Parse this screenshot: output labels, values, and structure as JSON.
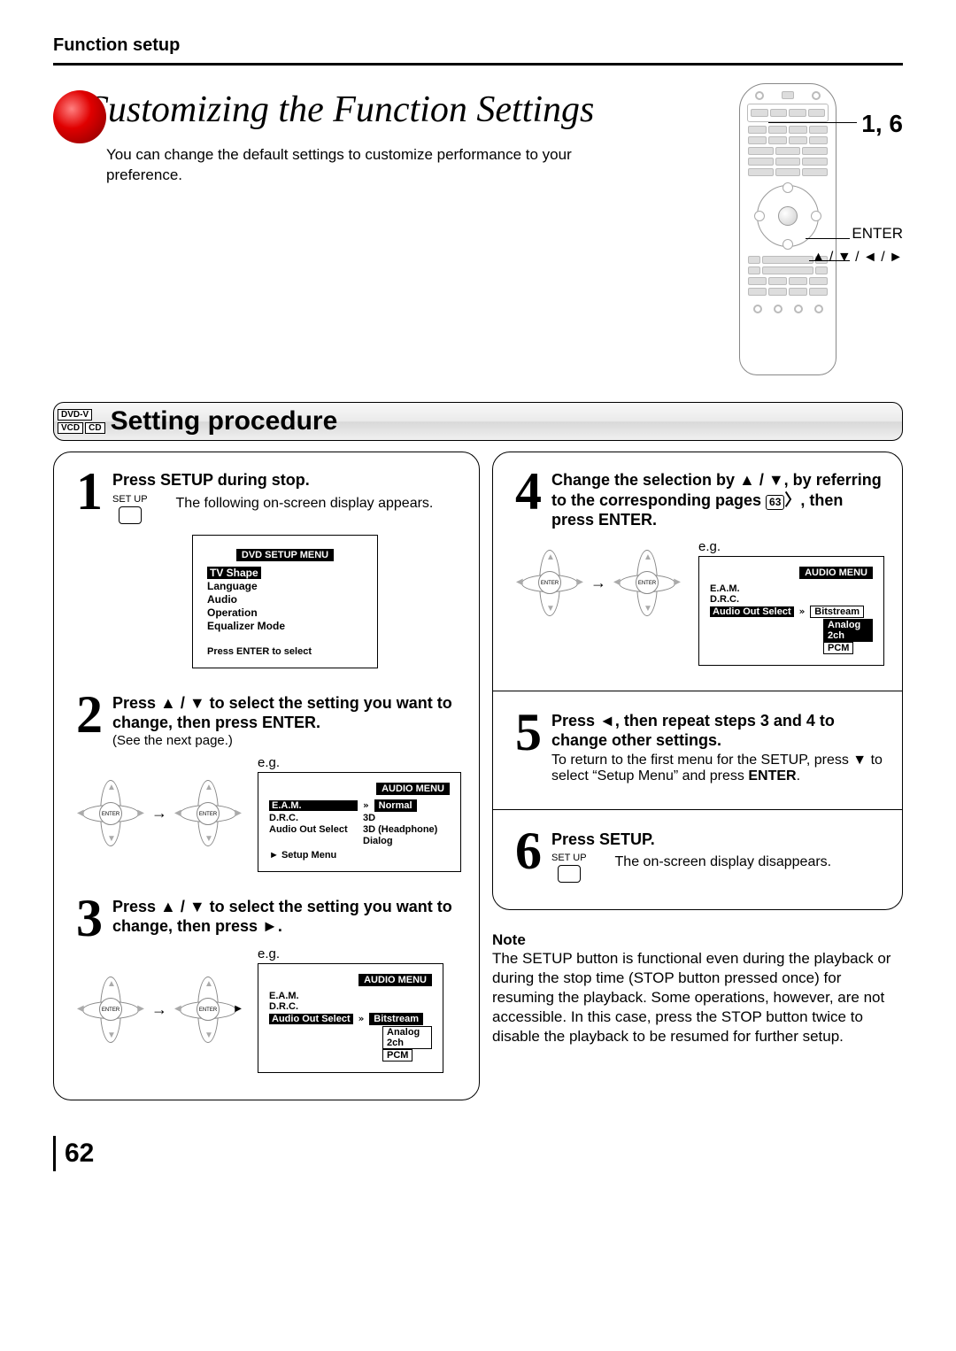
{
  "section_label": "Function setup",
  "main_title": "Customizing the Function Settings",
  "intro": "You can change the default settings to customize performance to your preference.",
  "remote": {
    "callout_steps": "1, 6",
    "callout_enter": "ENTER",
    "callout_arrows": "▲ / ▼ / ◄ / ►"
  },
  "badges": {
    "a": "DVD-V",
    "b": "VCD",
    "c": "CD"
  },
  "proc_title": "Setting procedure",
  "col_left": {
    "step1": {
      "num": "1",
      "head": "Press SETUP during stop.",
      "key_label": "SET UP",
      "sub": "The following on-screen display appears.",
      "osd": {
        "title": "DVD SETUP MENU",
        "items": [
          "TV Shape",
          "Language",
          "Audio",
          "Operation",
          "Equalizer Mode"
        ],
        "hint": "Press ENTER to select"
      }
    },
    "step2": {
      "num": "2",
      "head": "Press ▲ / ▼ to select the setting you want to change, then press ENTER.",
      "sub": "(See the next page.)",
      "eg": "e.g.",
      "osd": {
        "title": "AUDIO MENU",
        "rows": [
          {
            "lab": "E.A.M.",
            "mark": "»",
            "val": "Normal",
            "sel": true
          },
          {
            "lab": "D.R.C.",
            "val": "3D"
          },
          {
            "lab": "Audio Out Select",
            "val": "3D (Headphone)"
          },
          {
            "lab": "",
            "val": "Dialog"
          }
        ],
        "back": "► Setup Menu"
      }
    },
    "step3": {
      "num": "3",
      "head": "Press ▲ / ▼ to select the setting you want to change, then press ►.",
      "eg": "e.g.",
      "osd": {
        "title": "AUDIO MENU",
        "lines": [
          "E.A.M.",
          "D.R.C."
        ],
        "sel_label": "Audio Out Select",
        "mark": "»",
        "opts": [
          "Bitstream",
          "Analog 2ch",
          "PCM"
        ]
      }
    }
  },
  "col_right": {
    "step4": {
      "num": "4",
      "head_pre": "Change the selection by ▲ / ▼, by referring to the corresponding pages ",
      "pgref": "63",
      "head_post": ", then press ENTER.",
      "eg": "e.g.",
      "osd": {
        "title": "AUDIO MENU",
        "lines": [
          "E.A.M.",
          "D.R.C."
        ],
        "sel_label": "Audio Out Select",
        "mark": "»",
        "opts": [
          "Bitstream",
          "Analog 2ch",
          "PCM"
        ]
      }
    },
    "step5": {
      "num": "5",
      "head": "Press ◄, then repeat steps 3 and 4 to change other settings.",
      "text1": "To return to the first menu for the SETUP, press ▼ to select “Setup Menu” and press ",
      "text1_bold": "ENTER",
      "text1_end": "."
    },
    "step6": {
      "num": "6",
      "head": "Press SETUP.",
      "key_label": "SET UP",
      "sub": "The on-screen display disappears."
    }
  },
  "note": {
    "title": "Note",
    "text": "The SETUP button is functional even during the playback or during the stop time (STOP button pressed once) for resuming the playback. Some operations, however, are not accessible. In this case, press the STOP button twice to disable the playback to be resumed for further setup."
  },
  "page_number": "62"
}
